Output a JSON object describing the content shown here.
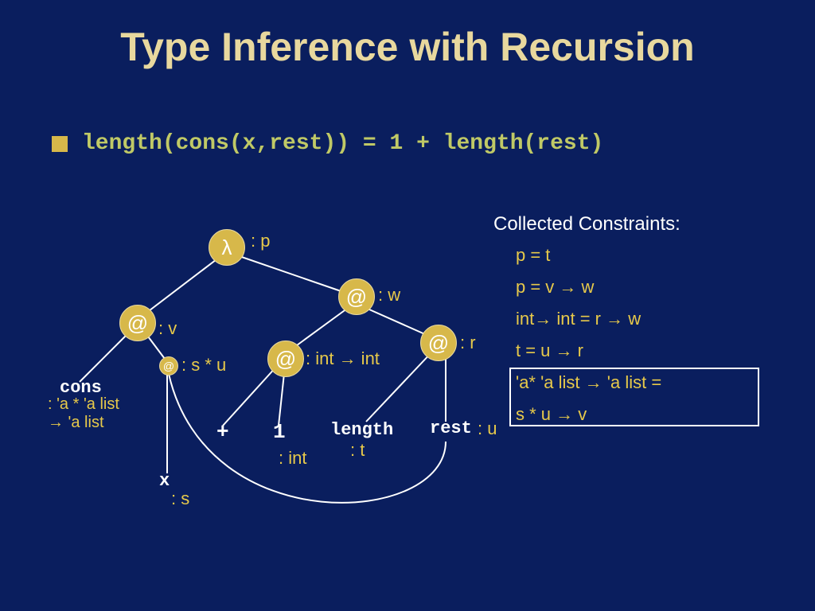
{
  "title": "Type Inference with Recursion",
  "expression": "length(cons(x,rest)) = 1 + length(rest)",
  "constraints_title": "Collected Constraints:",
  "constraints": {
    "c1": "p = t",
    "c2": "p = v → w",
    "c3": "int→ int = r → w",
    "c4": "t = u → r",
    "c5": "'a* 'a list → 'a list =",
    "c6": "s * u → v"
  },
  "nodes": {
    "lambda": {
      "label": "λ",
      "type": ": p"
    },
    "app_v": {
      "label": "@",
      "type": ": v"
    },
    "app_w": {
      "label": "@",
      "type": ": w"
    },
    "app_r": {
      "label": "@",
      "type": ": r"
    },
    "app_su": {
      "label": "@",
      "type": ": s * u"
    },
    "app_ii": {
      "label": "@",
      "type": ": int → int"
    }
  },
  "leaves": {
    "cons": {
      "label": "cons",
      "type_line1": ": 'a * 'a list",
      "type_line2": "→ 'a list"
    },
    "x": {
      "label": "x",
      "type": ": s"
    },
    "plus": {
      "label": "+",
      "type": ""
    },
    "one": {
      "label": "1",
      "type": ": int"
    },
    "length": {
      "label": "length",
      "type": ": t"
    },
    "rest": {
      "label": "rest",
      "type": ": u"
    }
  }
}
